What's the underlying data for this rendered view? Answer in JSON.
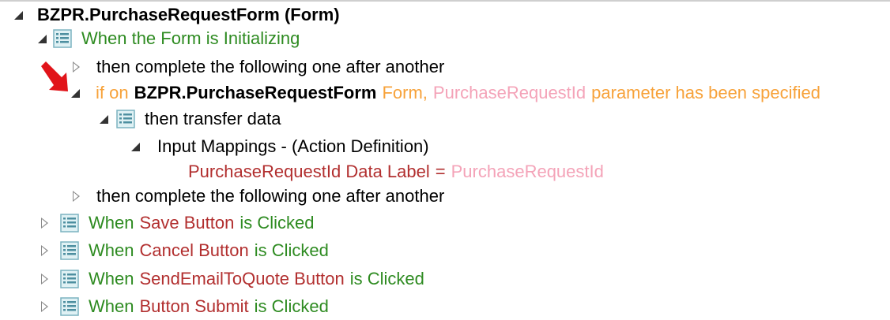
{
  "tree": {
    "root_label": "BZPR.PurchaseRequestForm (Form)",
    "init_event": "When the Form is Initializing",
    "then_complete_1": "then complete the following one after another",
    "condition": {
      "if_on": "if on",
      "form_name": "BZPR.PurchaseRequestForm",
      "form_word": "Form,",
      "param": "PurchaseRequestId",
      "tail": "parameter has been specified"
    },
    "transfer": "then transfer data",
    "input_mappings": "Input Mappings - (Action Definition)",
    "mapping": {
      "lhs": "PurchaseRequestId Data Label",
      "eq": "=",
      "rhs": "PurchaseRequestId"
    },
    "then_complete_2": "then complete the following one after another",
    "events": [
      {
        "when": "When",
        "subject": "Save Button",
        "action": "is Clicked"
      },
      {
        "when": "When",
        "subject": "Cancel Button",
        "action": "is Clicked"
      },
      {
        "when": "When",
        "subject": "SendEmailToQuote Button",
        "action": "is Clicked"
      },
      {
        "when": "When",
        "subject": "Button Submit",
        "action": "is Clicked"
      }
    ]
  },
  "annotation_icon": "red-arrow-icon",
  "colors": {
    "event_green": "#2e8b21",
    "subject_red": "#b22f2f",
    "keyword_orange": "#f7a23a",
    "param_pink": "#f4a3b8"
  }
}
